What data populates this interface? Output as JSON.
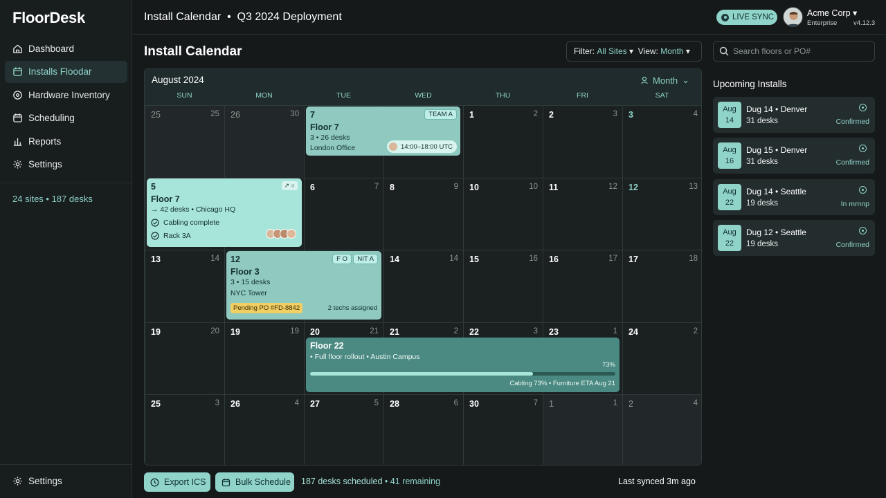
{
  "app": {
    "name": "FloorDesk"
  },
  "sidebar": {
    "items": [
      {
        "label": "Dashboard",
        "icon": "home-icon"
      },
      {
        "label": "Installs Floodar",
        "icon": "calendar-icon",
        "active": true
      },
      {
        "label": "Hardware Inventory",
        "icon": "tag-icon"
      },
      {
        "label": "Scheduling",
        "icon": "calendar-icon"
      },
      {
        "label": "Reports",
        "icon": "bar-chart-icon"
      },
      {
        "label": "Settings",
        "icon": "gear-icon"
      }
    ],
    "summary": "24 sites • 187 desks",
    "bottom_settings": "Settings"
  },
  "topbar": {
    "breadcrumb": "Install Calendar  •  Q3 2024 Deployment",
    "live_sync": "LIVE SYNC",
    "org_name": "Acme Corp",
    "org_plan": "Enterprise",
    "version": "v4.12.3"
  },
  "header": {
    "title": "Install Calendar",
    "filter_label": "Filter:",
    "filter_value": "All Sites",
    "view_label": "View:",
    "view_value": "Month",
    "search_placeholder": "Search floors or PO#"
  },
  "calendar": {
    "month": "August 2024",
    "view": "Month",
    "weekdays": [
      "SUN",
      "MON",
      "TUE",
      "WED",
      "THU",
      "FRI",
      "SAT"
    ],
    "weeks": [
      [
        {
          "n": "25",
          "c": "25",
          "dim": true
        },
        {
          "n": "26",
          "c": "30",
          "dim": true
        },
        {
          "n": "7",
          "c": ""
        },
        {
          "n": "",
          "c": ""
        },
        {
          "n": "1",
          "c": "2"
        },
        {
          "n": "2",
          "c": "3"
        },
        {
          "n": "3",
          "c": "4",
          "teal": true
        }
      ],
      [
        {
          "n": "5",
          "c": ""
        },
        {
          "n": "",
          "c": ""
        },
        {
          "n": "6",
          "c": "7"
        },
        {
          "n": "8",
          "c": "9"
        },
        {
          "n": "10",
          "c": "10"
        },
        {
          "n": "11",
          "c": "12"
        },
        {
          "n": "12",
          "c": "13",
          "teal": true
        }
      ],
      [
        {
          "n": "13",
          "c": "14"
        },
        {
          "n": "12",
          "c": ""
        },
        {
          "n": "",
          "c": ""
        },
        {
          "n": "14",
          "c": "14"
        },
        {
          "n": "15",
          "c": "16"
        },
        {
          "n": "16",
          "c": "17"
        },
        {
          "n": "17",
          "c": "18"
        }
      ],
      [
        {
          "n": "19",
          "c": "20"
        },
        {
          "n": "19",
          "c": "19"
        },
        {
          "n": "20",
          "c": "21"
        },
        {
          "n": "21",
          "c": "2"
        },
        {
          "n": "22",
          "c": "3"
        },
        {
          "n": "23",
          "c": "1"
        },
        {
          "n": "24",
          "c": "2"
        }
      ],
      [
        {
          "n": "25",
          "c": "3"
        },
        {
          "n": "26",
          "c": "4"
        },
        {
          "n": "27",
          "c": "5"
        },
        {
          "n": "28",
          "c": "6"
        },
        {
          "n": "30",
          "c": "7"
        },
        {
          "n": "1",
          "c": "1",
          "dim": true
        },
        {
          "n": "2",
          "c": "4",
          "dim": true
        }
      ]
    ],
    "events": {
      "ev1": {
        "date": "7",
        "tag": "TEAM A",
        "title": "Floor 7",
        "desks": "3 • 26 desks",
        "location": "London Office",
        "time": "14:00–18:00 UTC"
      },
      "ev2": {
        "date": "5",
        "title": "Floor 7",
        "desks": "→ 42 desks • Chicago HQ",
        "check1": "Cabling complete",
        "check2": "Rack 3A"
      },
      "ev3": {
        "date": "12",
        "tag1": "F O",
        "tag2": "NIT A",
        "title": "Floor 3",
        "desks": "3 • 15 desks",
        "location": "NYC Tower",
        "pending": "Pending PO #FD-8842",
        "techs": "2 techs assigned"
      },
      "ev4": {
        "title": "Floor 22",
        "desc": "• Full floor rollout • Austin Campus",
        "percent": "73%",
        "progress": 0.73,
        "footer": "Cabling 73% • Furniture ETA Aug 21"
      }
    }
  },
  "upcoming": {
    "title": "Upcoming Installs",
    "items": [
      {
        "month": "Aug",
        "day": "14",
        "name": "Dug 14 • Denver",
        "desks": "31 desks",
        "status": "Confirmed"
      },
      {
        "month": "Aug",
        "day": "16",
        "name": "Dug 15 • Denver",
        "desks": "31 desks",
        "status": "Confirmed"
      },
      {
        "month": "Aug",
        "day": "22",
        "name": "Dug 14 • Seattle",
        "desks": "19 desks",
        "status": "In mrnnp"
      },
      {
        "month": "Aug",
        "day": "22",
        "name": "Dug 12 • Seattle",
        "desks": "19 desks",
        "status": "Confirmed"
      }
    ]
  },
  "footer": {
    "export_label": "Export ICS",
    "bulk_label": "Bulk Schedule",
    "stat_desks": "187 desks scheduled",
    "stat_remaining": " • 41 remaining",
    "synced": "Last synced 3m ago"
  },
  "colors": {
    "accent": "#8fd3c9",
    "background": "#15191a",
    "pending": "#f2cf63"
  }
}
